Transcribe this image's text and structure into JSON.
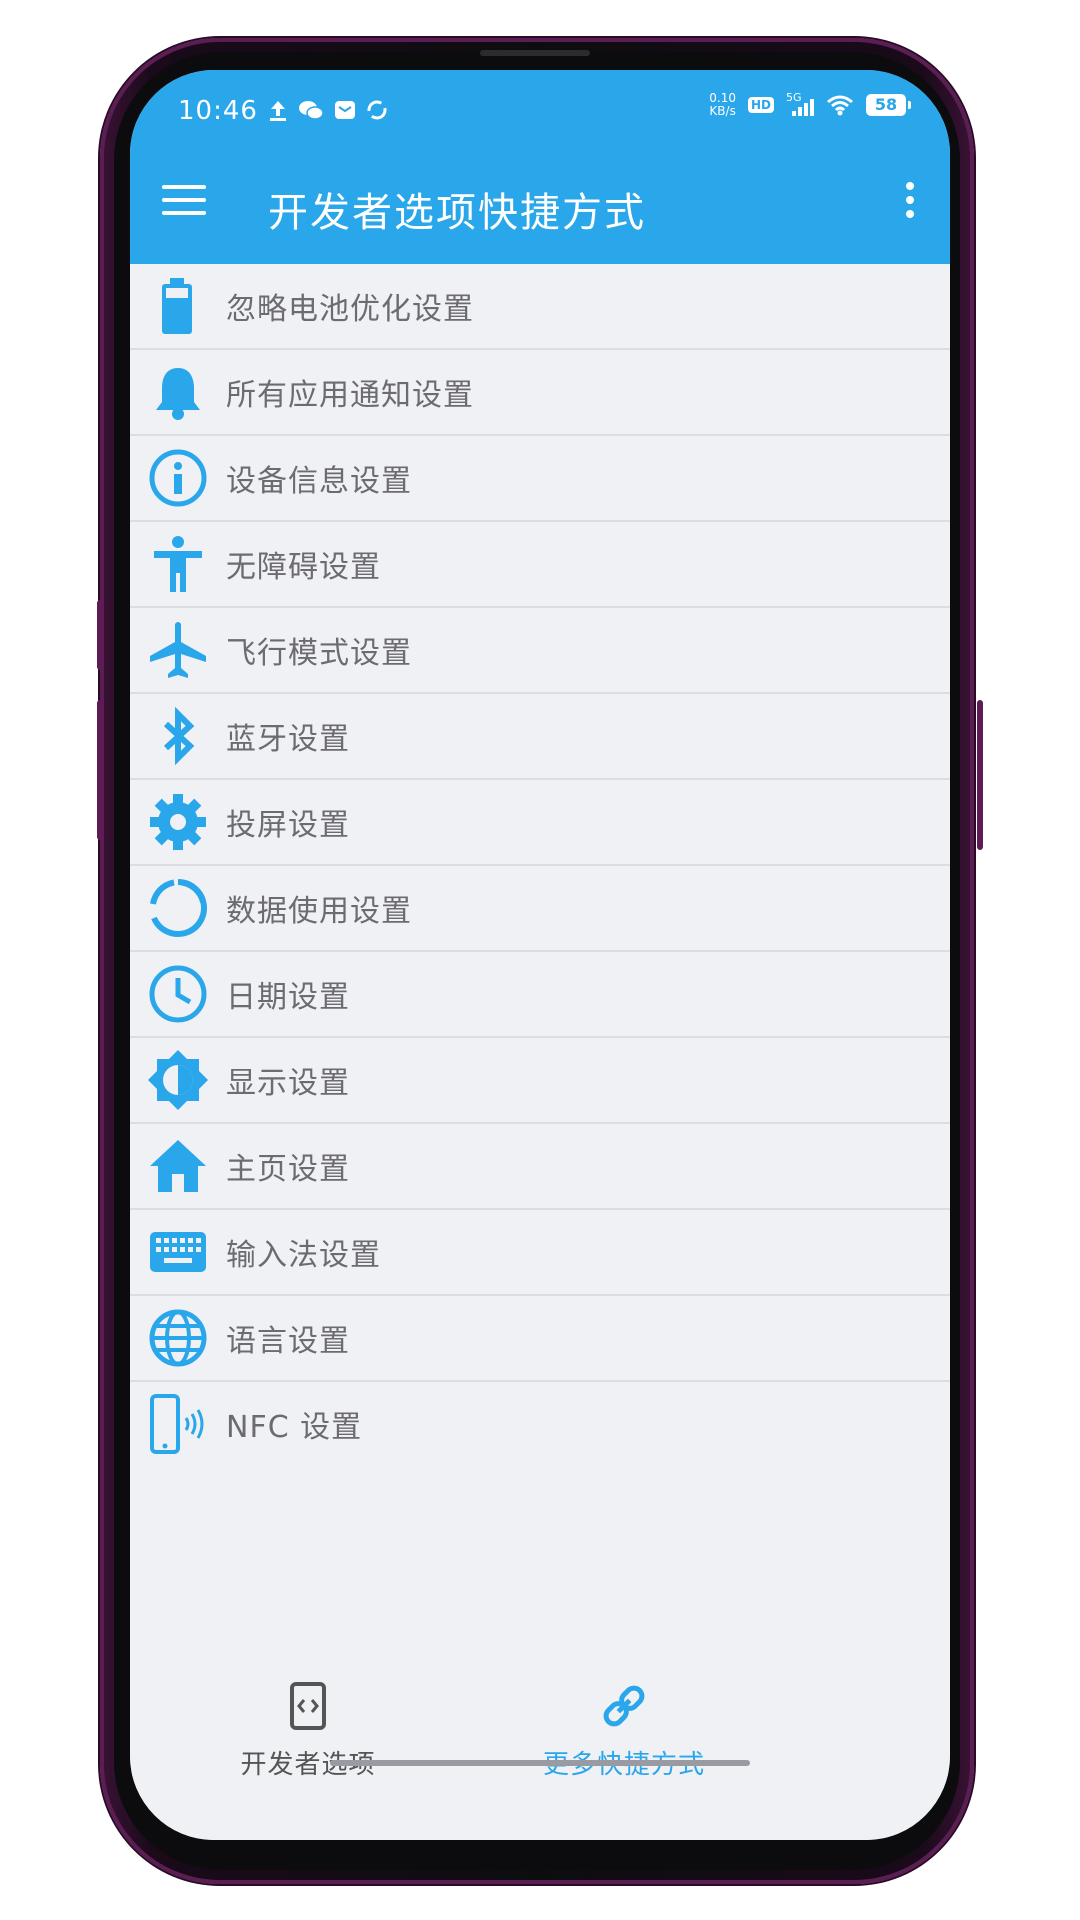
{
  "status_bar": {
    "time": "10:46",
    "net_speed_value": "0.10",
    "net_speed_unit": "KB/s",
    "hd": "HD",
    "signal": "5G",
    "battery": "58"
  },
  "appbar": {
    "title": "开发者选项快捷方式",
    "menu_icon": "hamburger-menu-icon",
    "overflow_icon": "more-vert-icon"
  },
  "colors": {
    "accent": "#2aa6ea",
    "icon": "#2aa6ea",
    "text": "#6c6c70"
  },
  "items": [
    {
      "label": "忽略电池优化设置",
      "icon": "battery-icon"
    },
    {
      "label": "所有应用通知设置",
      "icon": "bell-icon"
    },
    {
      "label": "设备信息设置",
      "icon": "info-icon"
    },
    {
      "label": "无障碍设置",
      "icon": "accessibility-icon"
    },
    {
      "label": "飞行模式设置",
      "icon": "airplane-icon"
    },
    {
      "label": "蓝牙设置",
      "icon": "bluetooth-icon"
    },
    {
      "label": "投屏设置",
      "icon": "gear-icon"
    },
    {
      "label": "数据使用设置",
      "icon": "data-usage-icon"
    },
    {
      "label": "日期设置",
      "icon": "clock-icon"
    },
    {
      "label": "显示设置",
      "icon": "brightness-icon"
    },
    {
      "label": "主页设置",
      "icon": "home-icon"
    },
    {
      "label": "输入法设置",
      "icon": "keyboard-icon"
    },
    {
      "label": "语言设置",
      "icon": "globe-icon"
    },
    {
      "label": "NFC 设置",
      "icon": "nfc-icon"
    }
  ],
  "bottom_nav": {
    "left": {
      "label": "开发者选项",
      "icon": "developer-mode-icon",
      "active": false
    },
    "right": {
      "label": "更多快捷方式",
      "icon": "link-icon",
      "active": true
    }
  }
}
